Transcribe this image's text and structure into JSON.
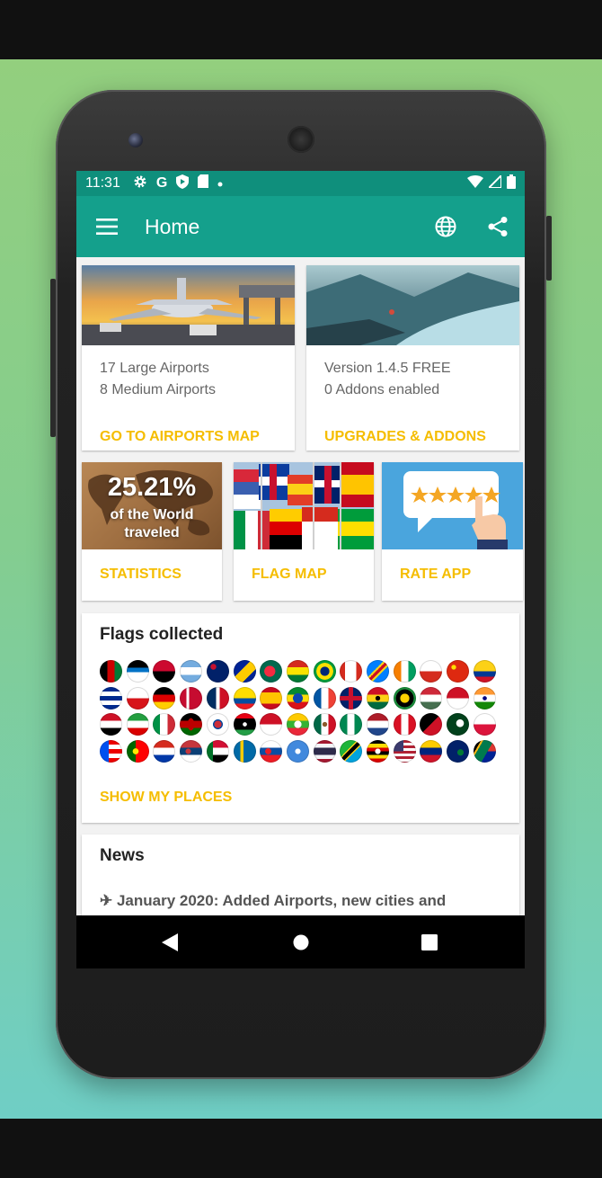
{
  "status_bar": {
    "time": "11:31",
    "left_icons": [
      "gear-icon",
      "google-icon",
      "shield-icon",
      "sd-card-icon",
      "dot-icon"
    ],
    "right_icons": [
      "wifi-icon",
      "signal-icon",
      "battery-icon"
    ]
  },
  "app_bar": {
    "title": "Home",
    "actions": [
      "globe-icon",
      "share-icon"
    ]
  },
  "airports_card": {
    "line1": "17 Large Airports",
    "line2": "8 Medium Airports",
    "action": "GO TO AIRPORTS MAP"
  },
  "upgrades_card": {
    "line1": "Version 1.4.5 FREE",
    "line2": "0 Addons enabled",
    "action": "UPGRADES & ADDONS"
  },
  "stats_card": {
    "percent": "25.21%",
    "caption_line1": "of the World",
    "caption_line2": "traveled",
    "action": "STATISTICS"
  },
  "flagmap_card": {
    "action": "FLAG MAP"
  },
  "rate_card": {
    "action": "RATE APP",
    "stars": 5
  },
  "flags_card": {
    "title": "Flags collected",
    "action": "SHOW MY PLACES",
    "rows": [
      [
        "Afghanistan",
        "Antigua and Barbuda",
        "Angola",
        "Argentina",
        "Australia",
        "Bosnia and Herzegovina",
        "Bangladesh",
        "Bolivia",
        "Brazil",
        "Canada",
        "DR Congo",
        "Ivory Coast",
        "Chile",
        "China",
        "Colombia"
      ],
      [
        "Cuba",
        "Czechia",
        "Germany",
        "Denmark",
        "Dominican Republic",
        "Ecuador",
        "Spain",
        "Ethiopia",
        "France",
        "United Kingdom",
        "Ghana",
        "Guadeloupe",
        "Hungary",
        "Indonesia",
        "India"
      ],
      [
        "Iraq",
        "Iran",
        "Italy",
        "Kenya",
        "South Korea",
        "Libya",
        "Monaco",
        "Myanmar",
        "Mexico",
        "Nigeria",
        "Netherlands",
        "Peru",
        "Papua New Guinea",
        "Pakistan",
        "Poland"
      ],
      [
        "Puerto Rico",
        "Portugal",
        "Paraguay",
        "Serbia",
        "Sudan",
        "Sweden",
        "Slovakia",
        "Somalia",
        "Thailand",
        "Tanzania",
        "Uganda",
        "United States",
        "Venezuela",
        "British Virgin Islands",
        "South Africa"
      ]
    ]
  },
  "news_card": {
    "title": "News",
    "item": "✈ January 2020: Added Airports, new cities and"
  },
  "nav_bar": [
    "back-icon",
    "home-icon",
    "recents-icon"
  ]
}
